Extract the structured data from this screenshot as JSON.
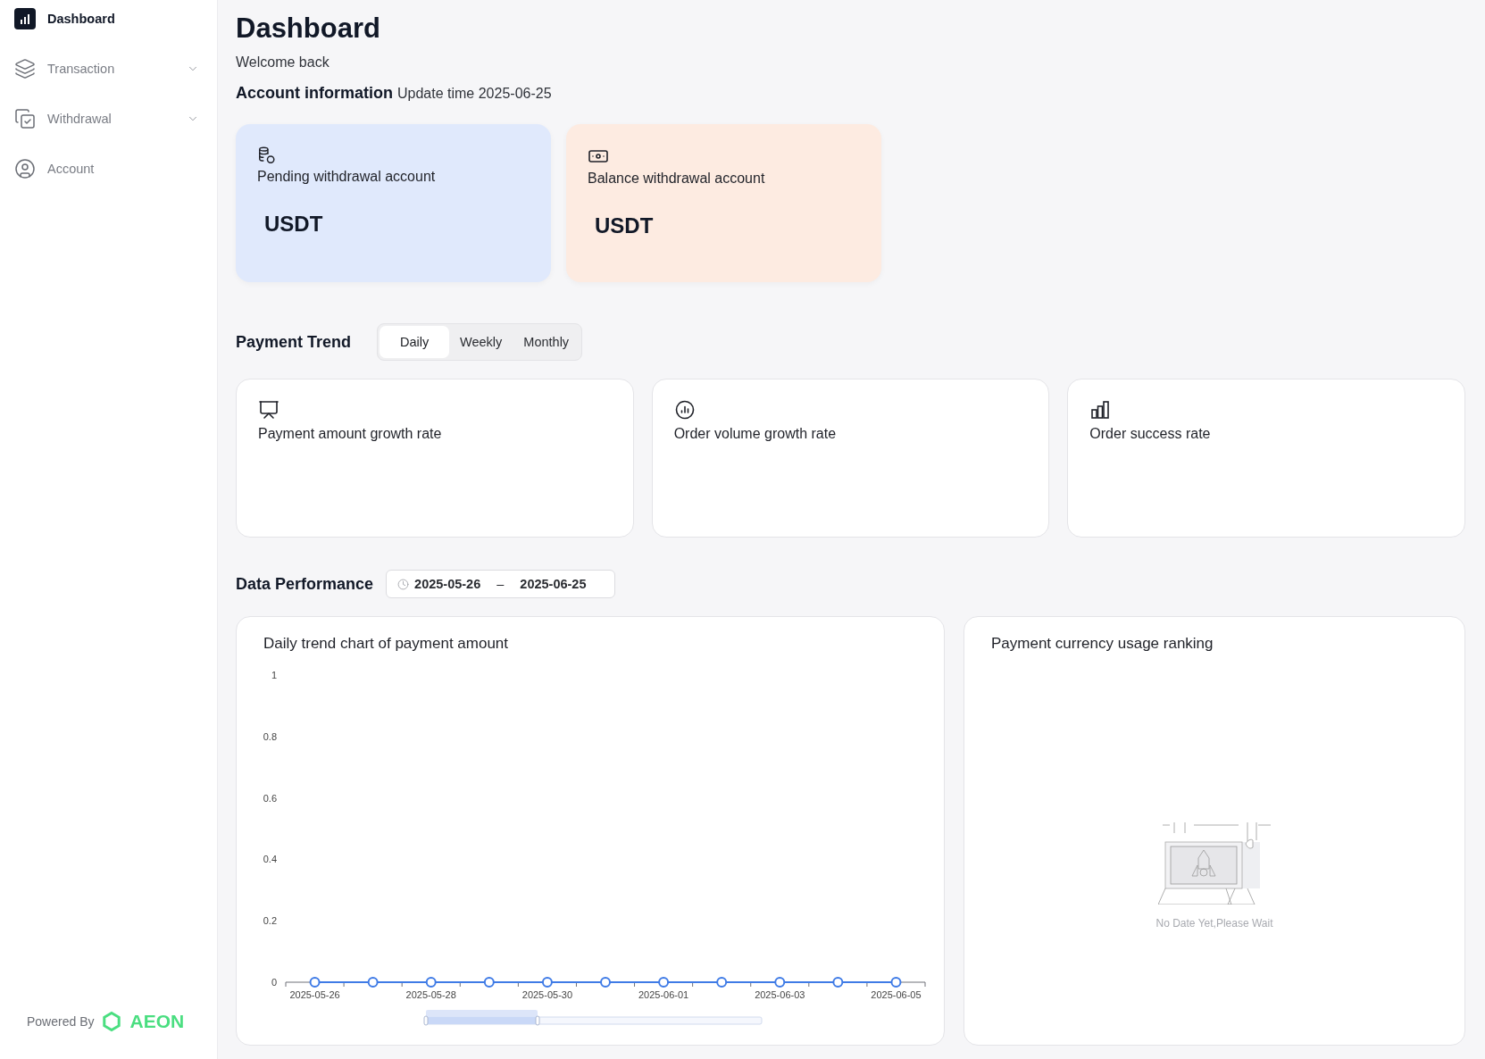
{
  "sidebar": {
    "items": [
      {
        "label": "Dashboard",
        "kind": "link",
        "selected": true
      },
      {
        "label": "Transaction",
        "kind": "group",
        "selected": false,
        "expanded": false
      },
      {
        "label": "Withdrawal",
        "kind": "group",
        "selected": false,
        "expanded": false
      },
      {
        "label": "Account",
        "kind": "link",
        "selected": false
      }
    ],
    "footer": {
      "prefix": "Powered By",
      "brand": "AEON"
    }
  },
  "header": {
    "title": "Dashboard",
    "subtitle": "Welcome back"
  },
  "account_information": {
    "title": "Account information",
    "update_time": "Update time 2025-06-25",
    "cards": [
      {
        "label": "Pending withdrawal account",
        "value": "USDT",
        "color": "#e0e9fc"
      },
      {
        "label": "Balance withdrawal account",
        "value": "USDT",
        "color": "#fdebe1"
      }
    ]
  },
  "payment_trend": {
    "title": "Payment Trend",
    "tabs": [
      {
        "label": "Daily",
        "selected": true
      },
      {
        "label": "Weekly",
        "selected": false
      },
      {
        "label": "Monthly",
        "selected": false
      }
    ],
    "cards": [
      {
        "label": "Payment amount growth rate"
      },
      {
        "label": "Order volume growth rate"
      },
      {
        "label": "Order success rate"
      }
    ]
  },
  "data_performance": {
    "title": "Data Performance",
    "date_range": {
      "start": "2025-05-26",
      "separator": "–",
      "end": "2025-06-25"
    },
    "trend_chart": {
      "chart_data": {
        "type": "line",
        "title": "Daily trend chart of payment amount",
        "categories": [
          "2025-05-26",
          null,
          "2025-05-28",
          null,
          "2025-05-30",
          null,
          "2025-06-01",
          null,
          "2025-06-03",
          null,
          "2025-06-05"
        ],
        "series": [
          {
            "color": "#3f7be6",
            "marker": "circle",
            "values": [
              0,
              0,
              0,
              0,
              0,
              0,
              0,
              0,
              0,
              0,
              0
            ]
          }
        ],
        "ylim": [
          0,
          1
        ],
        "yticks": [
          0,
          0.2,
          0.4,
          0.6,
          0.8,
          1
        ]
      }
    },
    "ranking": {
      "title": "Payment currency usage ranking",
      "empty_message": "No Date Yet,Please Wait"
    }
  }
}
